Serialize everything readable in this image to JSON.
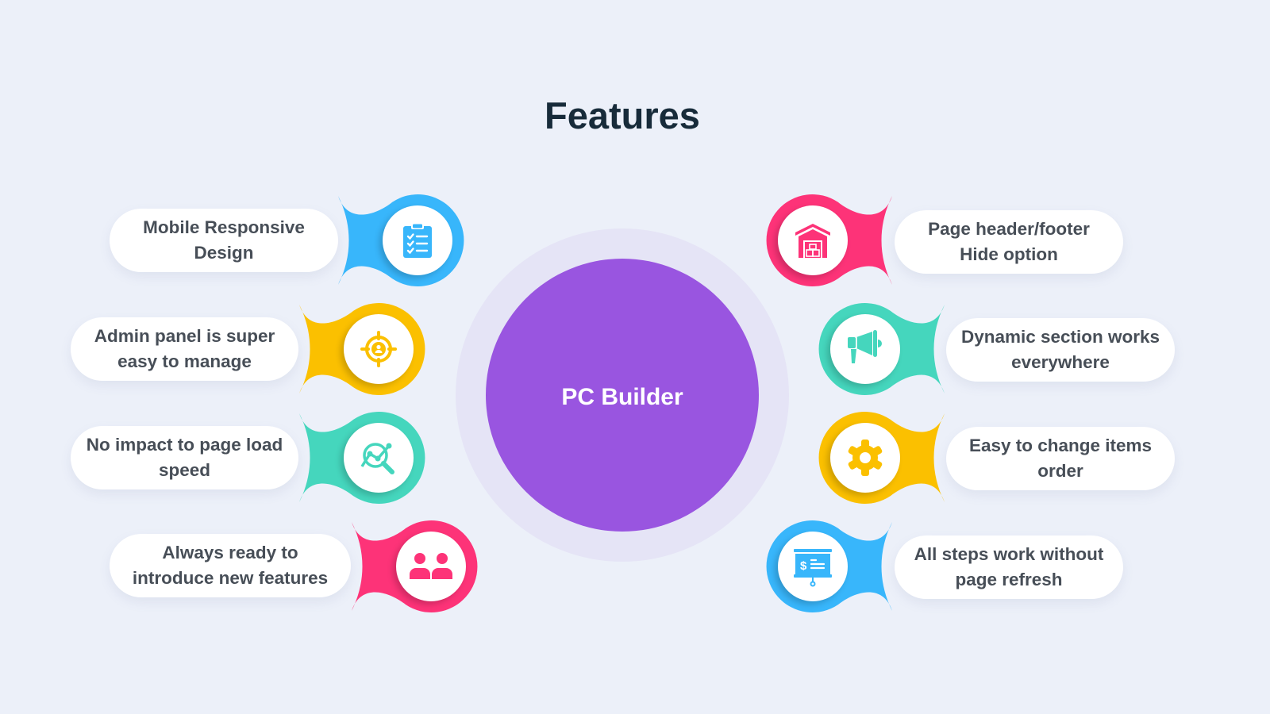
{
  "title": "Features",
  "center_label": "PC Builder",
  "colors": {
    "background": "#ecf0f9",
    "center": "#9955e0",
    "halo": "#e5e4f6",
    "blue": "#38b6fb",
    "yellow": "#fbc000",
    "teal": "#45d6bd",
    "pink": "#fd3378",
    "text": "#474e57",
    "title": "#172b3a"
  },
  "left_features": [
    {
      "label": "Mobile Responsive Design",
      "line1": "Mobile Responsive",
      "line2": "Design",
      "icon": "clipboard-checklist-icon",
      "color": "blue"
    },
    {
      "label": "Admin panel is super easy to manage",
      "line1": "Admin panel is super",
      "line2": "easy to manage",
      "icon": "target-user-icon",
      "color": "yellow"
    },
    {
      "label": "No impact to page load speed",
      "line1": "No impact to page load",
      "line2": "speed",
      "icon": "analytics-search-icon",
      "color": "teal"
    },
    {
      "label": "Always ready to introduce new features",
      "line1": "Always ready to",
      "line2": "introduce new features",
      "icon": "users-icon",
      "color": "pink"
    }
  ],
  "right_features": [
    {
      "label": "Page header/footer Hide option",
      "line1": "Page header/footer",
      "line2": "Hide option",
      "icon": "warehouse-icon",
      "color": "pink"
    },
    {
      "label": "Dynamic section works everywhere",
      "line1": "Dynamic section works",
      "line2": "everywhere",
      "icon": "megaphone-icon",
      "color": "teal"
    },
    {
      "label": "Easy to change items order",
      "line1": "Easy to change items",
      "line2": "order",
      "icon": "gear-icon",
      "color": "yellow"
    },
    {
      "label": "All steps work without page refresh",
      "line1": "All steps work without",
      "line2": "page refresh",
      "icon": "pricing-board-icon",
      "color": "blue"
    }
  ]
}
